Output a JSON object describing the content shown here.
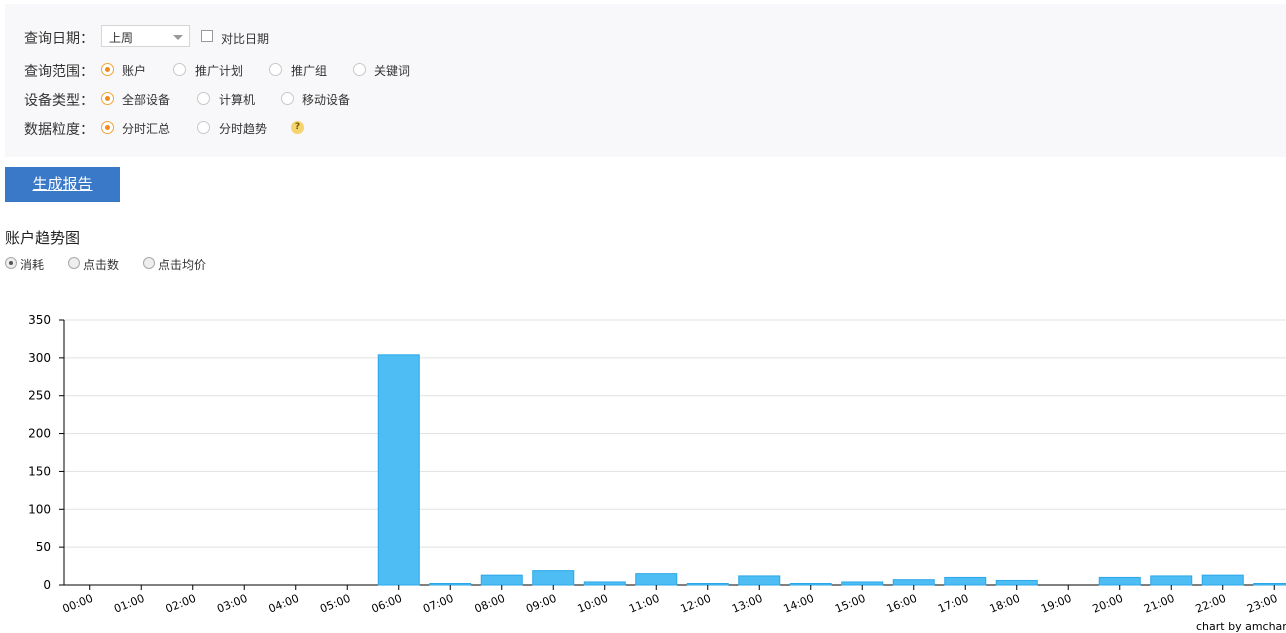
{
  "filters": {
    "date": {
      "label": "查询日期：",
      "selected": "上周",
      "compare_label": "对比日期"
    },
    "scope": {
      "label": "查询范围：",
      "options": [
        "账户",
        "推广计划",
        "推广组",
        "关键词"
      ],
      "selected_index": 0
    },
    "device": {
      "label": "设备类型：",
      "options": [
        "全部设备",
        "计算机",
        "移动设备"
      ],
      "selected_index": 0
    },
    "granularity": {
      "label": "数据粒度：",
      "options": [
        "分时汇总",
        "分时趋势"
      ],
      "selected_index": 0,
      "help": "?"
    }
  },
  "actions": {
    "generate_label": "生成报告"
  },
  "section": {
    "title": "账户趋势图"
  },
  "metrics": {
    "options": [
      "消耗",
      "点击数",
      "点击均价"
    ],
    "selected_index": 0
  },
  "chart_credit": "chart by amcharts",
  "colors": {
    "bar_fill": "#4dbdf4",
    "bar_stroke": "#2aa7e8",
    "button": "#3a78c8",
    "radio_selected": "#f08c1c"
  },
  "chart_data": {
    "type": "bar",
    "categories": [
      "00:00",
      "01:00",
      "02:00",
      "03:00",
      "04:00",
      "05:00",
      "06:00",
      "07:00",
      "08:00",
      "09:00",
      "10:00",
      "11:00",
      "12:00",
      "13:00",
      "14:00",
      "15:00",
      "16:00",
      "17:00",
      "18:00",
      "19:00",
      "20:00",
      "21:00",
      "22:00",
      "23:00"
    ],
    "values": [
      0,
      0,
      0,
      0,
      0,
      0,
      304,
      2,
      13,
      19,
      4,
      15,
      2,
      12,
      2,
      4,
      7,
      10,
      6,
      0,
      10,
      12,
      13,
      2
    ],
    "ylim": [
      0,
      350
    ],
    "yticks": [
      0,
      50,
      100,
      150,
      200,
      250,
      300,
      350
    ],
    "grid": true,
    "title": "",
    "xlabel": "",
    "ylabel": ""
  }
}
